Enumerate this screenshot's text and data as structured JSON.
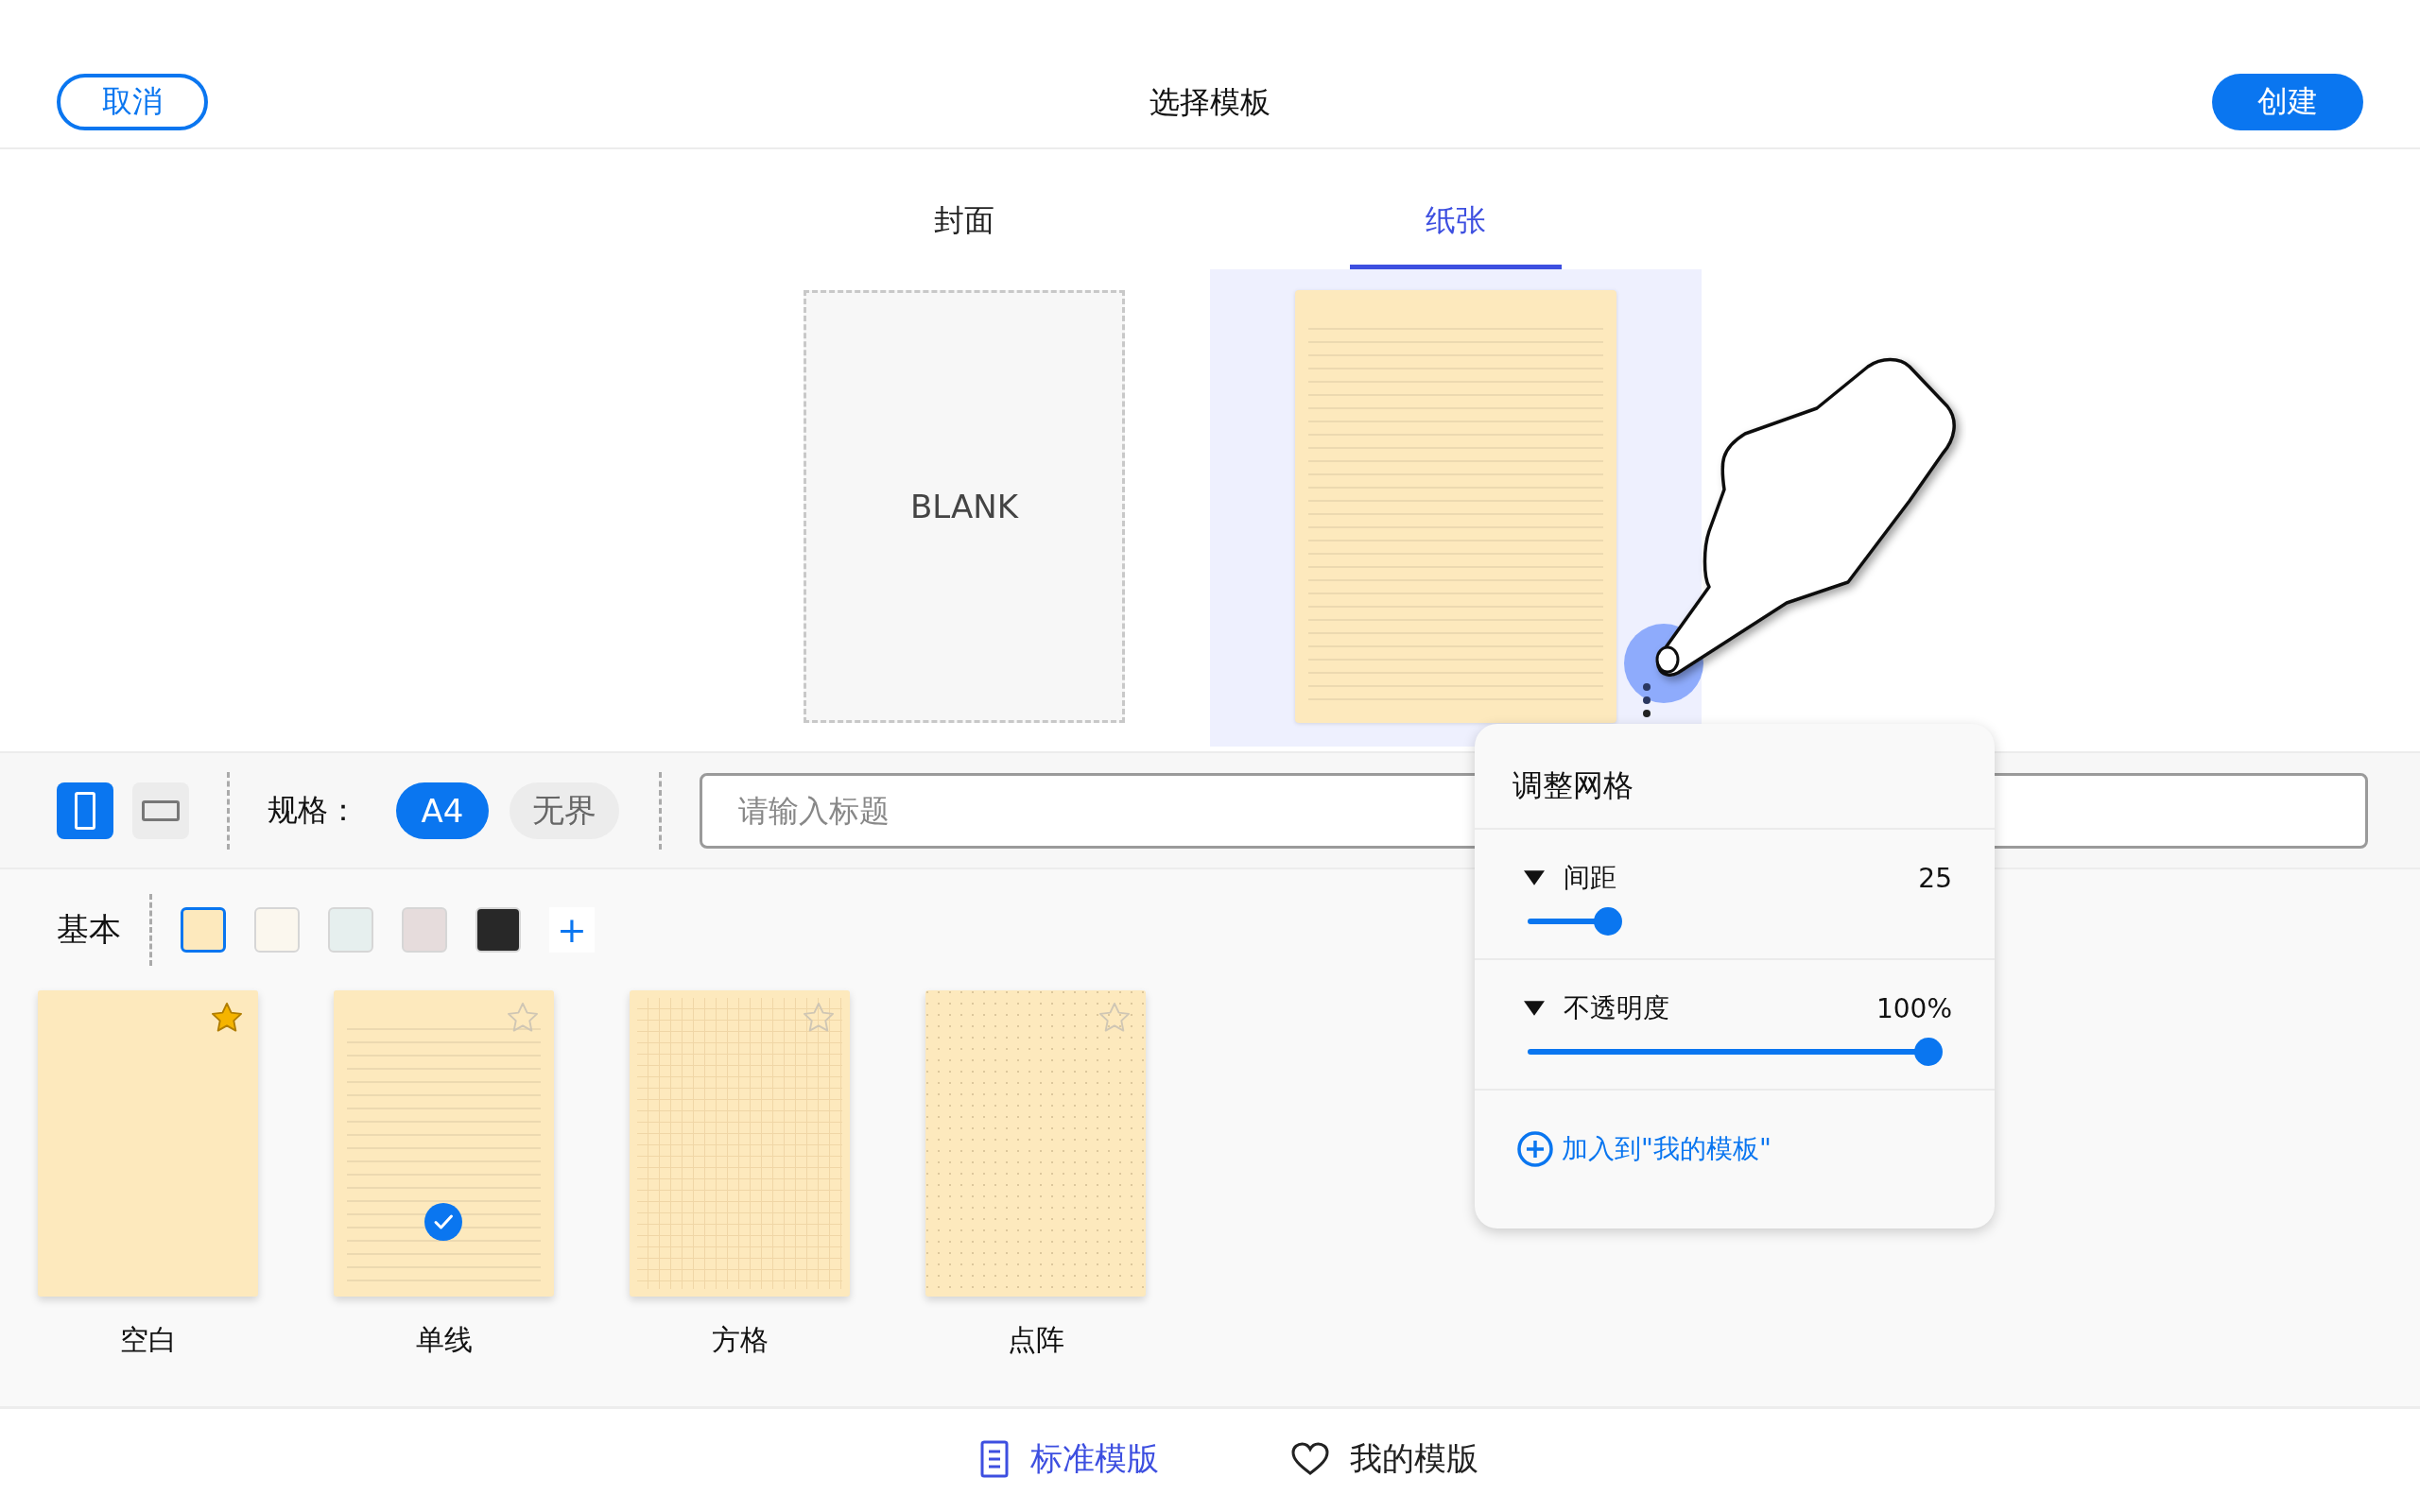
{
  "header": {
    "cancel": "取消",
    "title": "选择模板",
    "create": "创建"
  },
  "tabs": [
    {
      "label": "封面",
      "selected": false
    },
    {
      "label": "纸张",
      "selected": true
    }
  ],
  "preview": {
    "cover": {
      "label": "BLANK"
    },
    "paper": {
      "kind": "lined",
      "selected": true
    }
  },
  "toolbar": {
    "orientations": [
      {
        "kind": "portrait",
        "selected": true
      },
      {
        "kind": "landscape",
        "selected": false
      }
    ],
    "size_label": "规格：",
    "sizes": [
      {
        "label": "A4",
        "selected": true
      },
      {
        "label": "无界",
        "selected": false
      }
    ],
    "title_field": {
      "placeholder": "请输入标题"
    }
  },
  "colors": {
    "label": "基本",
    "swatches": [
      {
        "color": "#fde9bd",
        "selected": true
      },
      {
        "color": "#fbf7ee",
        "selected": false
      },
      {
        "color": "#e6efee",
        "selected": false
      },
      {
        "color": "#e6dcdc",
        "selected": false
      },
      {
        "color": "#282828",
        "selected": false
      }
    ],
    "add": "+"
  },
  "templates": [
    {
      "name": "空白",
      "kind": "blank",
      "favorite": true,
      "selected": false
    },
    {
      "name": "单线",
      "kind": "lined",
      "favorite": false,
      "selected": true
    },
    {
      "name": "方格",
      "kind": "grid",
      "favorite": false,
      "selected": false
    },
    {
      "name": "点阵",
      "kind": "dots",
      "favorite": false,
      "selected": false
    }
  ],
  "grid_popup": {
    "title": "调整网格",
    "sliders": [
      {
        "label": "间距",
        "value": "25",
        "expanded": true,
        "level": 0.17
      },
      {
        "label": "不透明度",
        "value": "100%",
        "expanded": true,
        "level": 1
      }
    ],
    "add_link": "加入到\"我的模板\""
  },
  "bottom_tabs": [
    {
      "label": "标准模版",
      "kind": "document",
      "selected": true
    },
    {
      "label": "我的模版",
      "kind": "heart",
      "selected": false
    }
  ]
}
